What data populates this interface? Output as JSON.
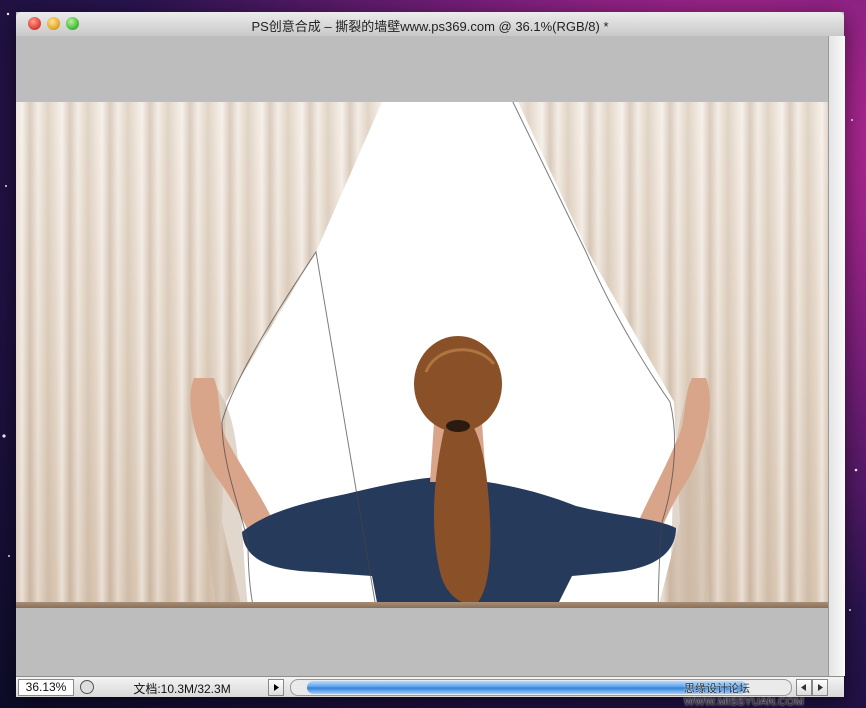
{
  "window": {
    "title": "PS创意合成 – 撕裂的墙壁www.ps369.com @ 36.1%(RGB/8) *"
  },
  "status": {
    "zoom": "36.13%",
    "doc_info": "文档:10.3M/32.3M",
    "watermark": "思缘设计论坛 WWW.MISSYUAN.COM"
  },
  "icons": {
    "close": "close-button-icon",
    "minimize": "minimize-button-icon",
    "zoom": "zoom-button-icon",
    "status_menu": "triangle-right-icon",
    "scroll_left": "arrow-left-icon",
    "scroll_right": "arrow-right-icon"
  },
  "colors": {
    "desktop_magenta": "#c52a9a",
    "canvas_gray": "#bdbdbd",
    "scroll_thumb_blue": "#4f9be8",
    "shirt_navy": "#263a5c",
    "hair_brown": "#8a5027"
  }
}
